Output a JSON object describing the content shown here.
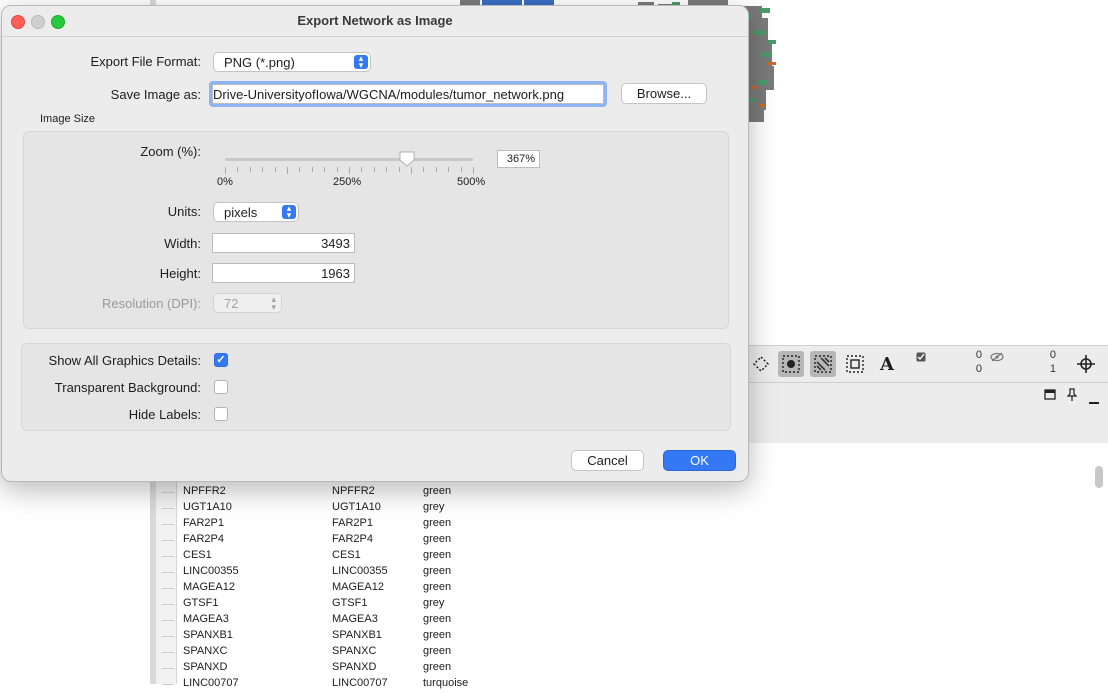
{
  "dialog": {
    "title": "Export Network as Image",
    "format_label": "Export File Format:",
    "format_value": "PNG (*.png)",
    "save_label": "Save Image as:",
    "save_path": "Drive-UniversityofIowa/WGCNA/modules/tumor_network.png",
    "browse_label": "Browse...",
    "image_size": {
      "title": "Image Size",
      "zoom_label": "Zoom (%):",
      "zoom_value": "367%",
      "zoom_percent": 367,
      "zoom_min_label": "0%",
      "zoom_mid_label": "250%",
      "zoom_max_label": "500%",
      "units_label": "Units:",
      "units_value": "pixels",
      "width_label": "Width:",
      "width_value": "3493",
      "height_label": "Height:",
      "height_value": "1963",
      "resolution_label": "Resolution (DPI):",
      "resolution_value": "72"
    },
    "options": {
      "show_details_label": "Show All Graphics Details:",
      "show_details_checked": true,
      "transparent_label": "Transparent Background:",
      "transparent_checked": false,
      "hide_labels_label": "Hide Labels:",
      "hide_labels_checked": false
    },
    "cancel_label": "Cancel",
    "ok_label": "OK"
  },
  "toolbar": {
    "selected_counts": [
      "0",
      "0"
    ],
    "hidden_counts": [
      "0",
      "1"
    ]
  },
  "table": {
    "rows": [
      [
        "NPFFR2",
        "NPFFR2",
        "green"
      ],
      [
        "UGT1A10",
        "UGT1A10",
        "grey"
      ],
      [
        "FAR2P1",
        "FAR2P1",
        "green"
      ],
      [
        "FAR2P4",
        "FAR2P4",
        "green"
      ],
      [
        "CES1",
        "CES1",
        "green"
      ],
      [
        "LINC00355",
        "LINC00355",
        "green"
      ],
      [
        "MAGEA12",
        "MAGEA12",
        "green"
      ],
      [
        "GTSF1",
        "GTSF1",
        "grey"
      ],
      [
        "MAGEA3",
        "MAGEA3",
        "green"
      ],
      [
        "SPANXB1",
        "SPANXB1",
        "green"
      ],
      [
        "SPANXC",
        "SPANXC",
        "green"
      ],
      [
        "SPANXD",
        "SPANXD",
        "green"
      ],
      [
        "LINC00707",
        "LINC00707",
        "turquoise"
      ]
    ]
  },
  "colors": {
    "accent": "#3478f6",
    "network_green": "#4c9a6a",
    "network_grey": "#7a7a7a",
    "network_blue": "#3a6fc4",
    "network_orange": "#d0672a"
  }
}
